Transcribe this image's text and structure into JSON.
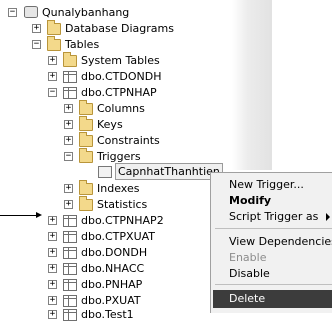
{
  "tree": {
    "root": "Qunalybanhang",
    "database_diagrams": "Database Diagrams",
    "tables": "Tables",
    "system_tables": "System Tables",
    "ctdondh": "dbo.CTDONDH",
    "ctpnhap": "dbo.CTPNHAP",
    "columns": "Columns",
    "keys": "Keys",
    "constraints": "Constraints",
    "triggers": "Triggers",
    "trigger_item": "CapnhatThanhtien",
    "indexes": "Indexes",
    "statistics": "Statistics",
    "ctpnhap2": "dbo.CTPNHAP2",
    "ctpxuat": "dbo.CTPXUAT",
    "dondh": "dbo.DONDH",
    "nhacc": "dbo.NHACC",
    "pnhap": "dbo.PNHAP",
    "pxuat": "dbo.PXUAT",
    "test1": "dbo.Test1"
  },
  "context_menu": {
    "new_trigger": "New Trigger...",
    "modify": "Modify",
    "script_trigger_as": "Script Trigger as",
    "view_dependencies": "View Dependencies",
    "enable": "Enable",
    "disable": "Disable",
    "delete": "Delete"
  },
  "expand_symbols": {
    "expanded": "−",
    "collapsed": "+"
  }
}
